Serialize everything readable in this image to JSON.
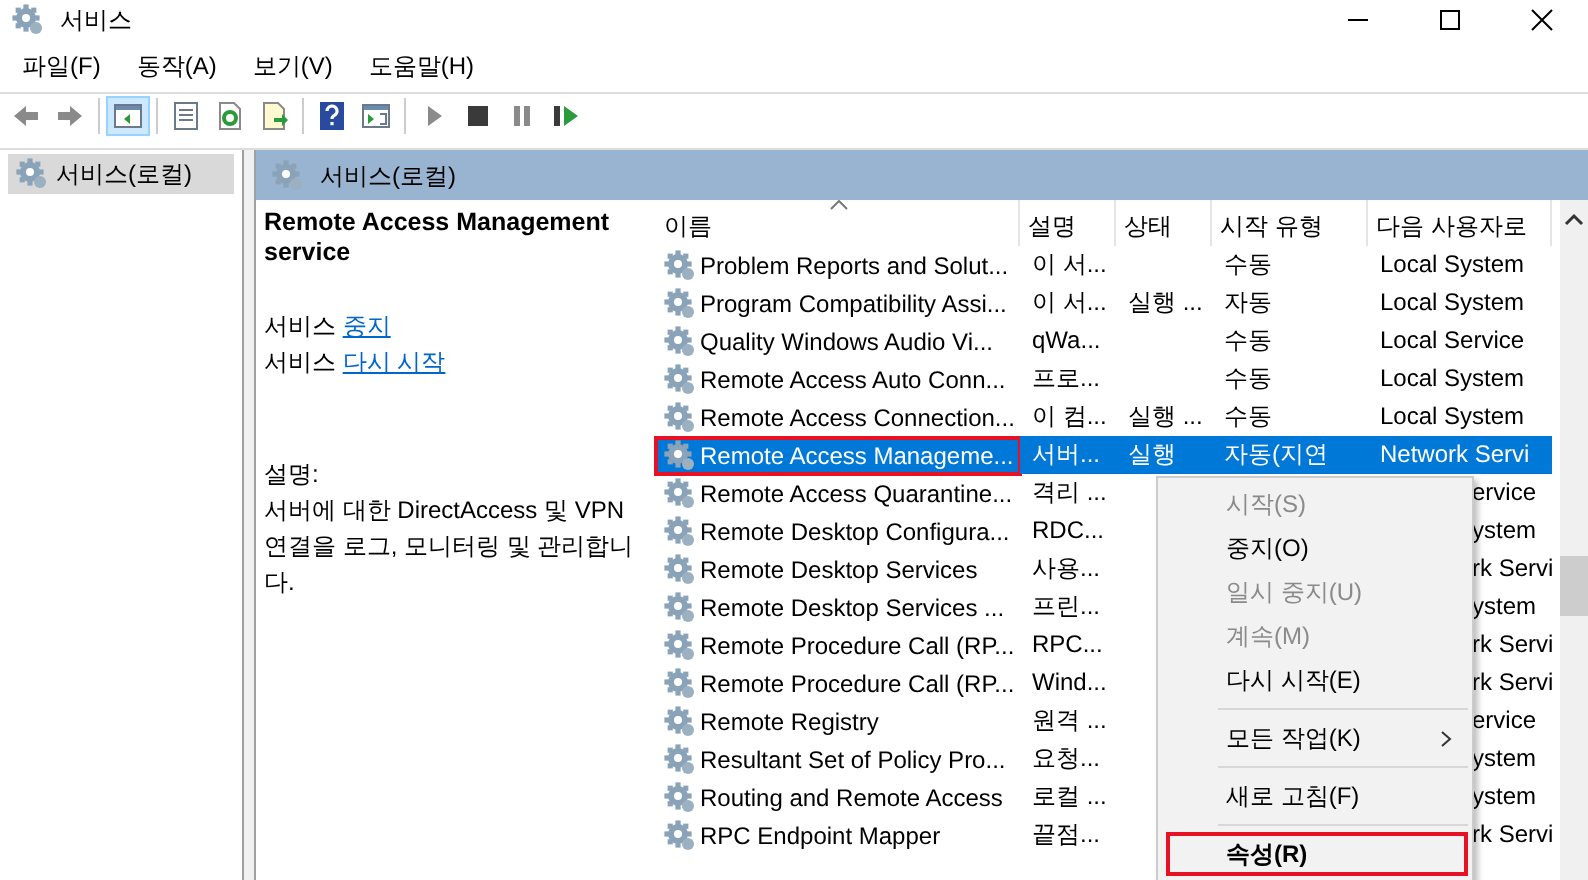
{
  "window": {
    "title": "서비스"
  },
  "menu": [
    {
      "label": "파일(F)"
    },
    {
      "label": "동작(A)"
    },
    {
      "label": "보기(V)"
    },
    {
      "label": "도움말(H)"
    }
  ],
  "toolbar": [
    {
      "kind": "back",
      "pressed": false
    },
    {
      "kind": "forward",
      "pressed": false
    },
    {
      "kind": "sep"
    },
    {
      "kind": "tree",
      "pressed": true
    },
    {
      "kind": "sep"
    },
    {
      "kind": "properties",
      "pressed": false
    },
    {
      "kind": "refresh",
      "pressed": false
    },
    {
      "kind": "export",
      "pressed": false
    },
    {
      "kind": "sep"
    },
    {
      "kind": "help",
      "pressed": false
    },
    {
      "kind": "actionpane",
      "pressed": false
    },
    {
      "kind": "sep"
    },
    {
      "kind": "play",
      "pressed": false
    },
    {
      "kind": "stop",
      "pressed": false
    },
    {
      "kind": "pause",
      "pressed": false
    },
    {
      "kind": "resume",
      "pressed": false
    }
  ],
  "tree": {
    "items": [
      {
        "label": "서비스(로컬)",
        "selected": true
      }
    ]
  },
  "pane_title": "서비스(로컬)",
  "details": {
    "title": "Remote Access Management service",
    "actions": [
      {
        "prefix": "서비스",
        "link": "중지"
      },
      {
        "prefix": "서비스",
        "link": "다시 시작"
      }
    ],
    "description_label": "설명:",
    "description": "서버에 대한 DirectAccess 및 VPN 연결을 로그, 모니터링 및 관리합니다."
  },
  "table": {
    "columns": [
      {
        "label": "이름",
        "sorted": true
      },
      {
        "label": "설명",
        "sorted": false
      },
      {
        "label": "상태",
        "sorted": false
      },
      {
        "label": "시작 유형",
        "sorted": false
      },
      {
        "label": "다음 사용자로",
        "sorted": false
      }
    ],
    "rows": [
      {
        "name": "Problem Reports and Solut...",
        "description": "이 서...",
        "startup": "수동",
        "user": "Local System",
        "selected": false,
        "covered": false
      },
      {
        "name": "Program Compatibility Assi...",
        "description": "이 서...",
        "status": "실행 ...",
        "startup": "자동",
        "user": "Local System",
        "selected": false,
        "covered": false
      },
      {
        "name": "Quality Windows Audio Vi...",
        "description": "qWa...",
        "startup": "수동",
        "user": "Local Service",
        "selected": false,
        "covered": false
      },
      {
        "name": "Remote Access Auto Conn...",
        "description": "프로...",
        "startup": "수동",
        "user": "Local System",
        "selected": false,
        "covered": false
      },
      {
        "name": "Remote Access Connection...",
        "description": "이 컴...",
        "status": "실행 ...",
        "startup": "수동",
        "user": "Local System",
        "selected": false,
        "covered": false
      },
      {
        "name": "Remote Access Manageme...",
        "description": "서버...",
        "status": "실행",
        "startup": "자동(지연",
        "user": "Network Servi",
        "selected": true,
        "covered": false
      },
      {
        "name": "Remote Access Quarantine...",
        "description": "격리 ...",
        "user": "ervice",
        "selected": false,
        "covered": true
      },
      {
        "name": "Remote Desktop Configura...",
        "description": "RDC...",
        "user": "ystem",
        "selected": false,
        "covered": true
      },
      {
        "name": "Remote Desktop Services",
        "description": "사용...",
        "user": "rk Servi",
        "selected": false,
        "covered": true
      },
      {
        "name": "Remote Desktop Services ...",
        "description": "프린...",
        "user": "ystem",
        "selected": false,
        "covered": true
      },
      {
        "name": "Remote Procedure Call (RP...",
        "description": "RPC...",
        "user": "rk Servi",
        "selected": false,
        "covered": true
      },
      {
        "name": "Remote Procedure Call (RP...",
        "description": "Wind...",
        "user": "rk Servi",
        "selected": false,
        "covered": true
      },
      {
        "name": "Remote Registry",
        "description": "원격 ...",
        "user": "ervice",
        "selected": false,
        "covered": true
      },
      {
        "name": "Resultant Set of Policy Pro...",
        "description": "요청...",
        "user": "ystem",
        "selected": false,
        "covered": true
      },
      {
        "name": "Routing and Remote Access",
        "description": "로컬 ...",
        "user": "ystem",
        "selected": false,
        "covered": true
      },
      {
        "name": "RPC Endpoint Mapper",
        "description": "끝점...",
        "user": "rk Servi",
        "selected": false,
        "covered": true
      }
    ]
  },
  "context_menu": {
    "items": [
      {
        "kind": "item",
        "label": "시작(S)",
        "disabled": true,
        "bold": false
      },
      {
        "kind": "item",
        "label": "중지(O)",
        "disabled": false,
        "bold": false
      },
      {
        "kind": "item",
        "label": "일시 중지(U)",
        "disabled": true,
        "bold": false
      },
      {
        "kind": "item",
        "label": "계속(M)",
        "disabled": true,
        "bold": false
      },
      {
        "kind": "item",
        "label": "다시 시작(E)",
        "disabled": false,
        "bold": false
      },
      {
        "kind": "separator"
      },
      {
        "kind": "submenu",
        "label": "모든 작업(K)",
        "disabled": false,
        "bold": false
      },
      {
        "kind": "separator"
      },
      {
        "kind": "item",
        "label": "새로 고침(F)",
        "disabled": false,
        "bold": false
      },
      {
        "kind": "separator"
      },
      {
        "kind": "item",
        "label": "속성(R)",
        "disabled": false,
        "bold": true
      }
    ]
  }
}
